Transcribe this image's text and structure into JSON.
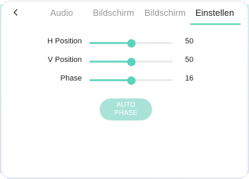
{
  "tabs": [
    {
      "label": "Audio",
      "active": false
    },
    {
      "label": "Bildschirm",
      "active": false
    },
    {
      "label": "Bildschirm",
      "active": false
    },
    {
      "label": "Einstellen",
      "active": true
    }
  ],
  "back_icon": "chevron-left-icon",
  "settings": [
    {
      "label": "H Position",
      "value": "50",
      "fraction": 0.5
    },
    {
      "label": "V Position",
      "value": "50",
      "fraction": 0.5
    },
    {
      "label": "Phase",
      "value": "16",
      "fraction": 0.5
    }
  ],
  "auto_phase": {
    "line1": "AUTO",
    "line2": "PHASE"
  },
  "colors": {
    "accent": "#55d3bb",
    "slider_fill": "#6fd8c3",
    "button_bg": "#a9e2d6",
    "inactive_tab": "#9a9a9a"
  }
}
